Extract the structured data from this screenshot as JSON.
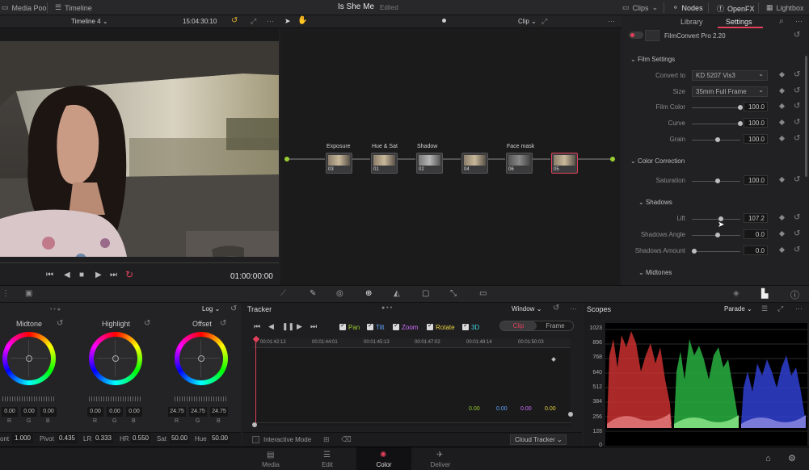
{
  "topbar": {
    "media_pool": "Media Pool",
    "timeline": "Timeline",
    "project_title": "Is She Me",
    "project_status": "Edited",
    "clips": "Clips",
    "nodes": "Nodes",
    "openfx": "OpenFX",
    "lightbox": "Lightbox"
  },
  "viewer": {
    "timeline_name": "Timeline 4",
    "timecode_top": "15:04:30:10",
    "timecode": "01:00:00:00"
  },
  "node_editor": {
    "clip_mode": "Clip",
    "nodes": [
      {
        "label": "Exposure",
        "num": "03"
      },
      {
        "label": "Hue & Sat",
        "num": "01"
      },
      {
        "label": "Shadow",
        "num": "02"
      },
      {
        "label": "",
        "num": "04"
      },
      {
        "label": "Face mask",
        "num": "06"
      },
      {
        "label": "",
        "num": "05"
      }
    ]
  },
  "inspector": {
    "tab_library": "Library",
    "tab_settings": "Settings",
    "effect_name": "FilmConvert Pro 2.20",
    "film_settings": "Film Settings",
    "convert_to_label": "Convert to",
    "convert_to_value": "KD 5207 Vis3",
    "size_label": "Size",
    "size_value": "35mm Full Frame",
    "film_color_label": "Film Color",
    "film_color_value": "100.0",
    "curve_label": "Curve",
    "curve_value": "100.0",
    "grain_label": "Grain",
    "grain_value": "100.0",
    "color_correction": "Color Correction",
    "saturation_label": "Saturation",
    "saturation_value": "100.0",
    "shadows": "Shadows",
    "lift_label": "Lift",
    "lift_value": "107.2",
    "shadows_angle_label": "Shadows Angle",
    "shadows_angle_value": "0.0",
    "shadows_amount_label": "Shadows Amount",
    "shadows_amount_value": "0.0",
    "midtones": "Midtones"
  },
  "wheels": {
    "mode": "Log",
    "items": [
      {
        "title": "Midtone",
        "r": "0.00",
        "g": "0.00",
        "b": "0.00"
      },
      {
        "title": "Highlight",
        "r": "0.00",
        "g": "0.00",
        "b": "0.00"
      },
      {
        "title": "Offset",
        "r": "24.75",
        "g": "24.75",
        "b": "24.75"
      }
    ],
    "rgb_r": "R",
    "rgb_g": "G",
    "rgb_b": "B"
  },
  "params": {
    "cont_label": "ont",
    "cont_value": "1.000",
    "pivot_label": "Pivot",
    "pivot_value": "0.435",
    "lr_label": "LR",
    "lr_value": "0.333",
    "hr_label": "HR",
    "hr_value": "0.550",
    "sat_label": "Sat",
    "sat_value": "50.00",
    "hue_label": "Hue",
    "hue_value": "50.00"
  },
  "tracker": {
    "title": "Tracker",
    "window": "Window",
    "pan": "Pan",
    "tilt": "Tilt",
    "zoom": "Zoom",
    "rotate": "Rotate",
    "3d": "3D",
    "clip": "Clip",
    "frame": "Frame",
    "timecodes": [
      "00:01:42:12",
      "00:01:44:01",
      "00:01:45:13",
      "00:01:47:02",
      "00:01:48:14",
      "00:01:50:03"
    ],
    "readouts": [
      "0.00",
      "0.00",
      "0.00",
      "0.00"
    ],
    "interactive_mode": "Interactive Mode",
    "cloud_tracker": "Cloud Tracker"
  },
  "scopes": {
    "title": "Scopes",
    "mode": "Parade",
    "ylabels": [
      "1023",
      "896",
      "768",
      "640",
      "512",
      "384",
      "256",
      "128",
      "0"
    ]
  },
  "pagenav": {
    "media": "Media",
    "edit": "Edit",
    "color": "Color",
    "deliver": "Deliver"
  },
  "colors": {
    "accent": "#e0405a",
    "active_tab": "#2a2a2c"
  }
}
